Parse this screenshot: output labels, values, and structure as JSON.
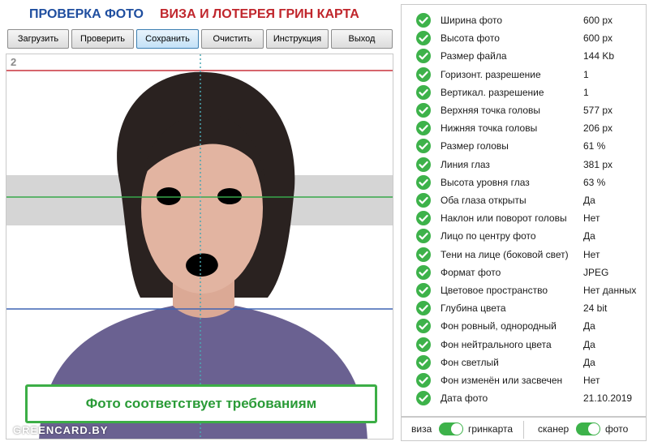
{
  "header": {
    "title_left": "ПРОВЕРКА ФОТО",
    "title_right": "ВИЗА И ЛОТЕРЕЯ ГРИН КАРТА"
  },
  "toolbar": {
    "load": "Загрузить",
    "check": "Проверить",
    "save": "Сохранить",
    "clear": "Очистить",
    "instructions": "Инструкция",
    "exit": "Выход"
  },
  "photo": {
    "corner_number": "2",
    "verdict": "Фото соответствует требованиям",
    "watermark": "GREENCARD.BY"
  },
  "checks": [
    {
      "label": "Ширина фото",
      "value": "600 px",
      "status": "ok"
    },
    {
      "label": "Высота фото",
      "value": "600 px",
      "status": "ok"
    },
    {
      "label": "Размер файла",
      "value": "144 Kb",
      "status": "ok"
    },
    {
      "label": "Горизонт. разрешение",
      "value": "1",
      "status": "ok"
    },
    {
      "label": "Вертикал. разрешение",
      "value": "1",
      "status": "ok"
    },
    {
      "label": "Верхняя точка головы",
      "value": "577 px",
      "status": "ok"
    },
    {
      "label": "Нижняя точка головы",
      "value": "206 px",
      "status": "ok"
    },
    {
      "label": "Размер головы",
      "value": "61 %",
      "status": "ok"
    },
    {
      "label": "Линия глаз",
      "value": "381 px",
      "status": "ok"
    },
    {
      "label": "Высота уровня глаз",
      "value": "63 %",
      "status": "ok"
    },
    {
      "label": "Оба глаза открыты",
      "value": "Да",
      "status": "ok"
    },
    {
      "label": "Наклон или поворот головы",
      "value": "Нет",
      "status": "ok"
    },
    {
      "label": "Лицо по центру фото",
      "value": "Да",
      "status": "ok"
    },
    {
      "label": "Тени на лице (боковой свет)",
      "value": "Нет",
      "status": "ok"
    },
    {
      "label": "Формат фото",
      "value": "JPEG",
      "status": "ok"
    },
    {
      "label": "Цветовое пространство",
      "value": "Нет данных",
      "status": "ok"
    },
    {
      "label": "Глубина цвета",
      "value": "24 bit",
      "status": "ok"
    },
    {
      "label": "Фон ровный, однородный",
      "value": "Да",
      "status": "ok"
    },
    {
      "label": "Фон нейтрального цвета",
      "value": "Да",
      "status": "ok"
    },
    {
      "label": "Фон светлый",
      "value": "Да",
      "status": "ok"
    },
    {
      "label": "Фон изменён или засвечен",
      "value": "Нет",
      "status": "ok"
    },
    {
      "label": "Дата фото",
      "value": "21.10.2019",
      "status": "ok"
    }
  ],
  "switches": {
    "mode_left": "виза",
    "mode_right": "гринкарта",
    "mode_on": true,
    "source_left": "сканер",
    "source_right": "фото",
    "source_on": true
  },
  "colors": {
    "accent_green": "#3db24a",
    "title_blue": "#1f4e9f",
    "title_red": "#c0262c",
    "top_line": "#c8323c",
    "eye_line": "#37a84a",
    "chin_line": "#3f64b4",
    "center_line": "#4aa8b3"
  }
}
